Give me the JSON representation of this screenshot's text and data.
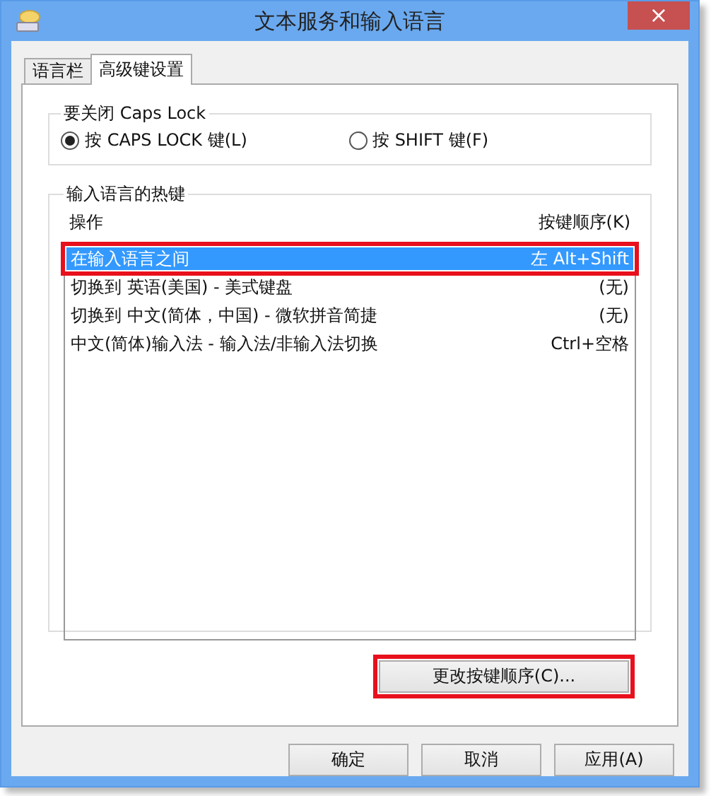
{
  "window": {
    "title": "文本服务和输入语言",
    "close": "×"
  },
  "tabs": [
    {
      "label": "语言栏",
      "selected": false
    },
    {
      "label": "高级键设置",
      "selected": true
    }
  ],
  "caps_lock_group": {
    "title": "要关闭 Caps Lock",
    "options": [
      {
        "label": "按 CAPS LOCK 键(L)",
        "selected": true
      },
      {
        "label": "按 SHIFT 键(F)",
        "selected": false
      }
    ]
  },
  "hotkeys_group": {
    "title": "输入语言的热键",
    "columns": [
      "操作",
      "按键顺序(K)"
    ],
    "rows": [
      {
        "action": "在输入语言之间",
        "keys": "左 Alt+Shift",
        "selected": true,
        "highlighted": true
      },
      {
        "action": "切换到 英语(美国) - 美式键盘",
        "keys": "(无)",
        "selected": false,
        "highlighted": false
      },
      {
        "action": "切换到 中文(简体，中国) - 微软拼音简捷",
        "keys": "(无)",
        "selected": false,
        "highlighted": false
      },
      {
        "action": "中文(简体)输入法 - 输入法/非输入法切换",
        "keys": "Ctrl+空格",
        "selected": false,
        "highlighted": false
      }
    ],
    "change_button": {
      "label": "更改按键顺序(C)...",
      "highlighted": true
    }
  },
  "buttons": [
    "确定",
    "取消",
    "应用(A)"
  ]
}
